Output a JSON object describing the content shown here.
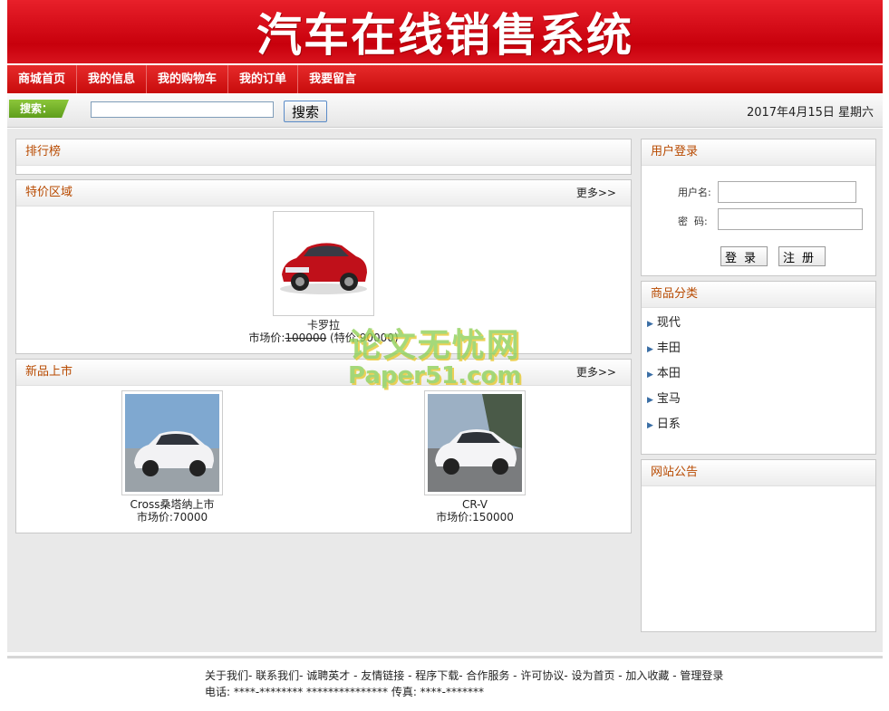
{
  "header": {
    "title": "汽车在线销售系统"
  },
  "nav": {
    "items": [
      "商城首页",
      "我的信息",
      "我的购物车",
      "我的订单",
      "我要留言"
    ]
  },
  "search": {
    "label": "搜索：",
    "button": "搜索",
    "value": "",
    "placeholder": ""
  },
  "date": "2017年4月15日  星期六",
  "ranking": {
    "title": "排行榜"
  },
  "specials": {
    "title": "特价区域",
    "more": "更多>>",
    "items": [
      {
        "name": "卡罗拉",
        "price_label": "市场价:",
        "market_price": "100000",
        "special_label": "(特价:90000)"
      }
    ]
  },
  "new_arrivals": {
    "title": "新品上市",
    "more": "更多>>",
    "items": [
      {
        "name": "Cross桑塔纳上市",
        "price": "市场价:70000"
      },
      {
        "name": "CR-V",
        "price": "市场价:150000"
      }
    ]
  },
  "login": {
    "title": "用户登录",
    "username_label": "用户名:",
    "password_label": "密  码:",
    "login_button": "登录",
    "register_button": "注册"
  },
  "categories": {
    "title": "商品分类",
    "items": [
      "现代",
      "丰田",
      "本田",
      "宝马",
      "日系"
    ]
  },
  "notice": {
    "title": "网站公告"
  },
  "watermark": {
    "line1": "论文无忧网",
    "line2": "Paper51.com"
  },
  "footer": {
    "links": "关于我们- 联系我们- 诚聘英才 - 友情链接 - 程序下载- 合作服务 - 许可协议- 设为首页 - 加入收藏 - 管理登录",
    "contact": "电话: ****-******** ***************  传真: ****-*******"
  },
  "colors": {
    "brand_red": "#d8141e",
    "panel_title": "#b84a00",
    "search_green": "#6aab26"
  }
}
